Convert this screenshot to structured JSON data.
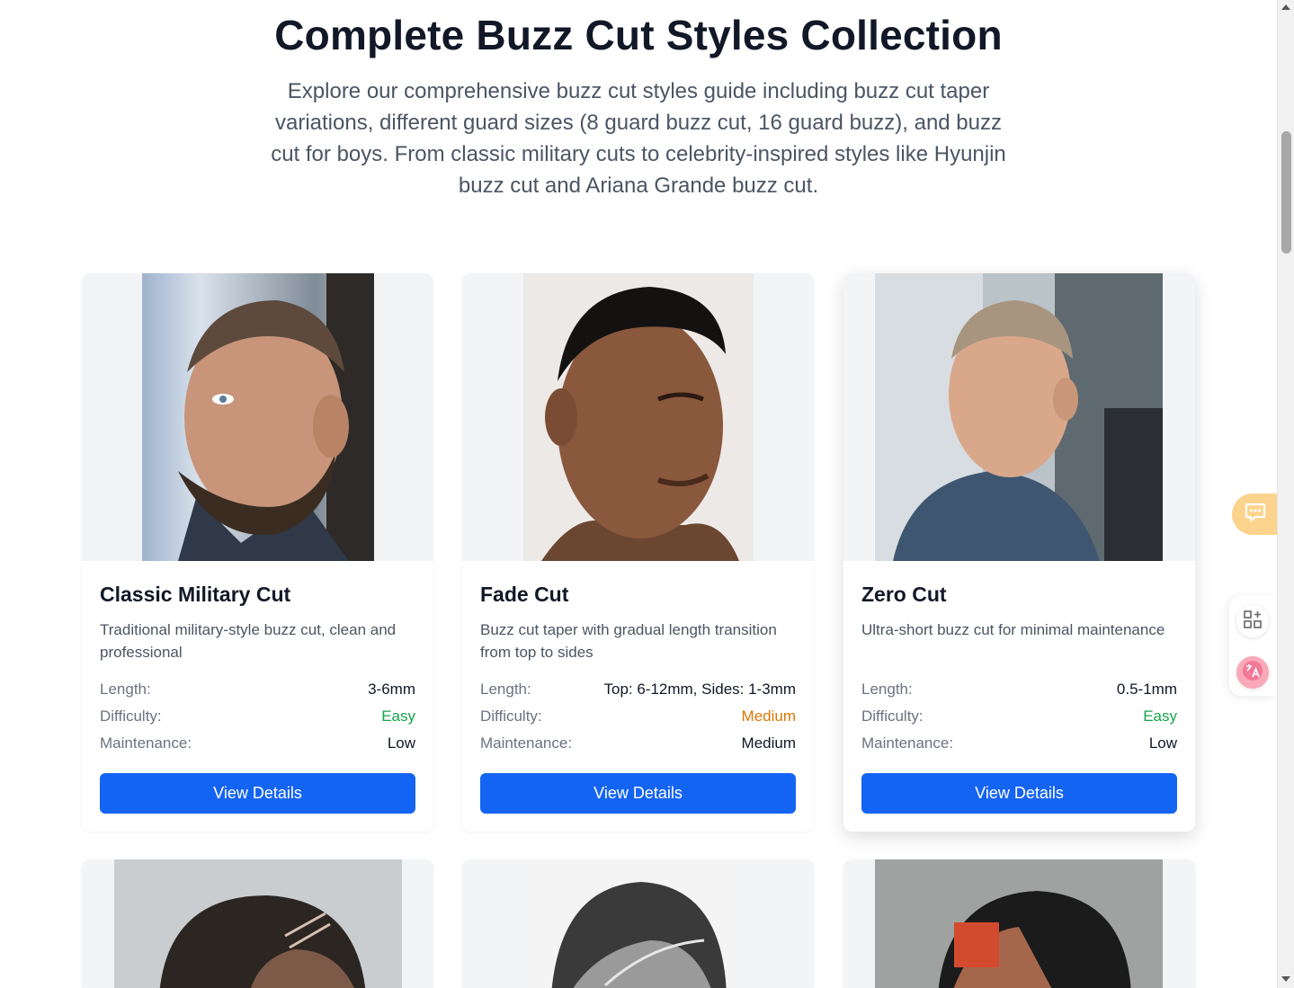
{
  "header": {
    "title": "Complete Buzz Cut Styles Collection",
    "subtitle": "Explore our comprehensive buzz cut styles guide including buzz cut taper variations, different guard sizes (8 guard buzz cut, 16 guard buzz), and buzz cut for boys. From classic military cuts to celebrity-inspired styles like Hyunjin buzz cut and Ariana Grande buzz cut."
  },
  "spec_labels": {
    "length": "Length:",
    "difficulty": "Difficulty:",
    "maintenance": "Maintenance:"
  },
  "cards": [
    {
      "title": "Classic Military Cut",
      "description": "Traditional military-style buzz cut, clean and professional",
      "length": "3-6mm",
      "difficulty": "Easy",
      "maintenance": "Low",
      "button": "View Details"
    },
    {
      "title": "Fade Cut",
      "description": "Buzz cut taper with gradual length transition from top to sides",
      "length": "Top: 6-12mm, Sides: 1-3mm",
      "difficulty": "Medium",
      "maintenance": "Medium",
      "button": "View Details"
    },
    {
      "title": "Zero Cut",
      "description": "Ultra-short buzz cut for minimal maintenance",
      "length": "0.5-1mm",
      "difficulty": "Easy",
      "maintenance": "Low",
      "button": "View Details"
    }
  ],
  "colors": {
    "primary_button": "#1464f4",
    "easy": "#16a34a",
    "medium": "#d97706",
    "chat_widget": "#fcd38d"
  },
  "icons": {
    "chat": "chat-bubble-icon",
    "apps": "apps-grid-icon",
    "translate": "translate-icon"
  }
}
